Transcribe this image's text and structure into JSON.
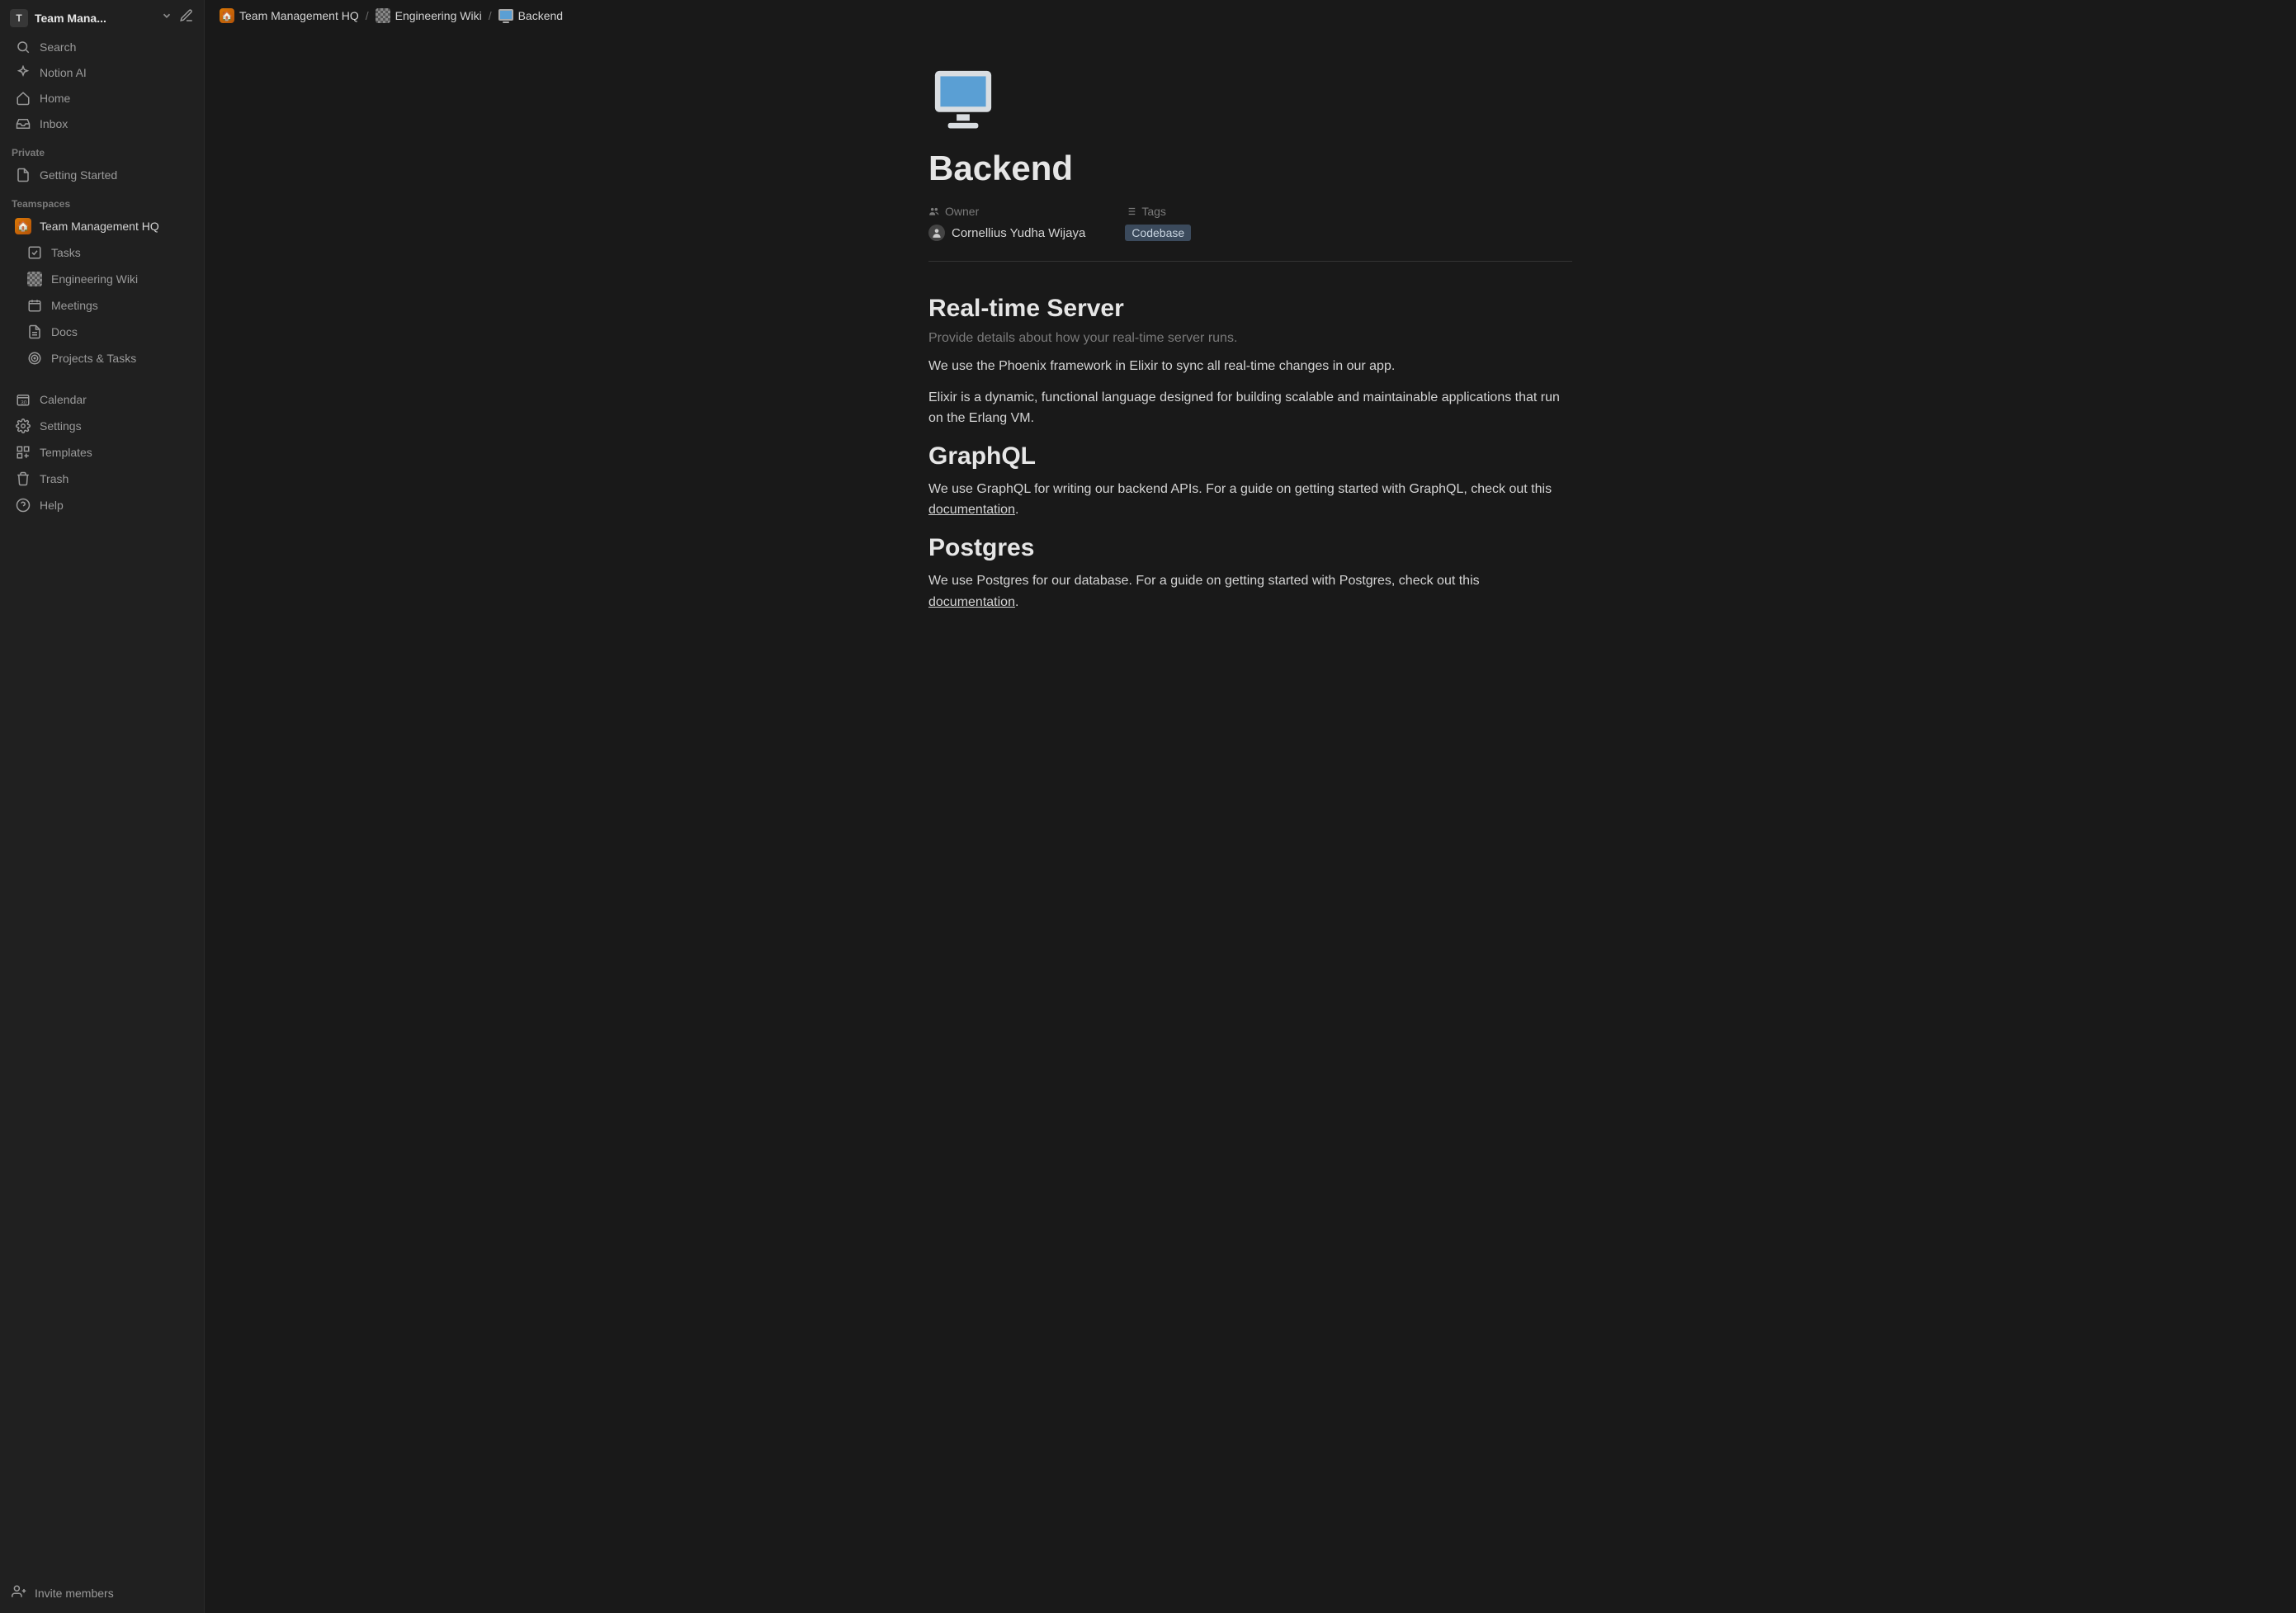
{
  "workspace": {
    "badge_letter": "T",
    "name": "Team Mana..."
  },
  "sidebar_top": [
    {
      "icon": "search",
      "label": "Search"
    },
    {
      "icon": "ai",
      "label": "Notion AI"
    },
    {
      "icon": "home",
      "label": "Home"
    },
    {
      "icon": "inbox",
      "label": "Inbox"
    }
  ],
  "sidebar": {
    "private_label": "Private",
    "private_items": [
      {
        "icon": "page",
        "label": "Getting Started"
      }
    ],
    "teamspaces_label": "Teamspaces",
    "teamspace_name": "Team Management HQ",
    "teamspace_children": [
      {
        "icon": "check",
        "label": "Tasks"
      },
      {
        "icon": "wiki",
        "label": "Engineering Wiki"
      },
      {
        "icon": "calendar-sm",
        "label": "Meetings"
      },
      {
        "icon": "page",
        "label": "Docs"
      },
      {
        "icon": "target",
        "label": "Projects & Tasks"
      }
    ]
  },
  "sidebar_bottom": [
    {
      "icon": "calendar",
      "label": "Calendar"
    },
    {
      "icon": "settings",
      "label": "Settings"
    },
    {
      "icon": "templates",
      "label": "Templates"
    },
    {
      "icon": "trash",
      "label": "Trash"
    },
    {
      "icon": "help",
      "label": "Help"
    }
  ],
  "invite_label": "Invite members",
  "breadcrumb": [
    {
      "icon": "house",
      "label": "Team Management HQ"
    },
    {
      "icon": "wiki",
      "label": "Engineering Wiki"
    },
    {
      "icon": "monitor",
      "label": "Backend"
    }
  ],
  "page": {
    "title": "Backend",
    "owner_label": "Owner",
    "owner_value": "Cornellius Yudha Wijaya",
    "tags_label": "Tags",
    "tags": [
      "Codebase"
    ],
    "sections": [
      {
        "heading": "Real-time Server",
        "subtitle": "Provide details about how your real-time server runs.",
        "paragraphs": [
          "We use the Phoenix framework in Elixir to sync all real-time changes in our app.",
          "Elixir is a dynamic, functional language designed for building scalable and maintainable applications that run on the Erlang VM."
        ]
      },
      {
        "heading": "GraphQL",
        "link_paragraph": {
          "before": "We use GraphQL for writing our backend APIs. For a guide on getting started with GraphQL, check out this ",
          "link": "documentation",
          "after": "."
        }
      },
      {
        "heading": "Postgres",
        "link_paragraph": {
          "before": "We use Postgres for our database. For a guide on getting started with Postgres, check out this ",
          "link": "documentation",
          "after": "."
        }
      }
    ]
  }
}
